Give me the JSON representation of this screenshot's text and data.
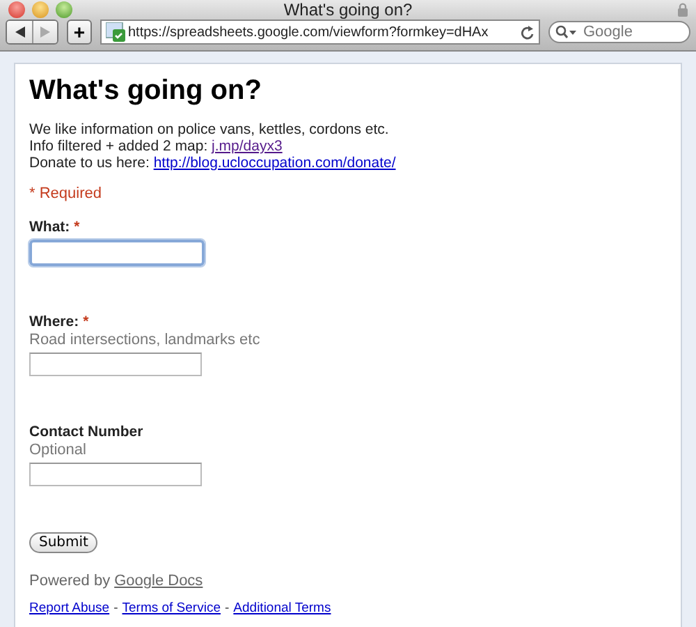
{
  "window": {
    "title": "What's going on?"
  },
  "toolbar": {
    "url": "https://spreadsheets.google.com/viewform?formkey=dHAx",
    "search_placeholder": "Google",
    "add_button": "+",
    "back_enabled": true,
    "forward_enabled": false
  },
  "form": {
    "title": "What's going on?",
    "description": [
      {
        "text": "We like information on police vans, kettles, cordons etc."
      },
      {
        "text": "Info filtered + added 2 map: ",
        "link": "j.mp/dayx3",
        "visited": true
      },
      {
        "text": "Donate to us here: ",
        "link": "http://blog.ucloccupation.com/donate/",
        "visited": false
      }
    ],
    "required_note": "* Required",
    "fields": [
      {
        "label": "What:",
        "required": true,
        "required_mark": "*",
        "focused": true
      },
      {
        "label": "Where:",
        "required": true,
        "required_mark": "*",
        "help": "Road intersections, landmarks etc",
        "focused": false
      },
      {
        "label": "Contact Number",
        "required": false,
        "help": "Optional",
        "focused": false
      }
    ],
    "submit": "Submit",
    "powered_by": "Powered by",
    "powered_link": "Google Docs",
    "footer_links": [
      "Report Abuse",
      "Terms of Service",
      "Additional Terms"
    ],
    "footer_separator": "-"
  }
}
